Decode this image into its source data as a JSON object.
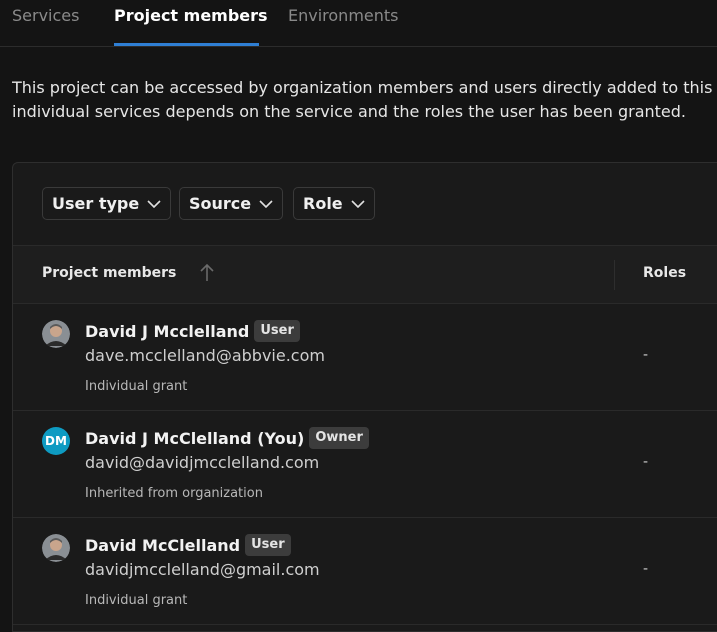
{
  "tabs": [
    {
      "label": "Services",
      "active": false
    },
    {
      "label": "Project members",
      "active": true
    },
    {
      "label": "Environments",
      "active": false
    }
  ],
  "description": {
    "line1": "This project can be accessed by organization members and users directly added to this p",
    "line2": "individual services depends on the service and the roles the user has been granted."
  },
  "filters": {
    "user_type": "User type",
    "source": "Source",
    "role": "Role"
  },
  "table": {
    "col_members": "Project members",
    "col_roles": "Roles",
    "sort": "ascending",
    "rows": [
      {
        "name": "David J Mcclelland",
        "badge": "User",
        "email": "dave.mcclelland@abbvie.com",
        "source": "Individual grant",
        "role": "-",
        "avatar": "photo"
      },
      {
        "name": "David J McClelland (You)",
        "badge": "Owner",
        "email": "david@davidjmcclelland.com",
        "source": "Inherited from organization",
        "role": "-",
        "avatar_initials": "DM",
        "avatar_color": "#0e9bc2"
      },
      {
        "name": "David McClelland",
        "badge": "User",
        "email": "davidjmcclelland@gmail.com",
        "source": "Individual grant",
        "role": "-",
        "avatar": "photo"
      }
    ]
  },
  "colors": {
    "accent": "#2f7fd4",
    "background": "#141414",
    "panel": "#1a1a1a"
  }
}
